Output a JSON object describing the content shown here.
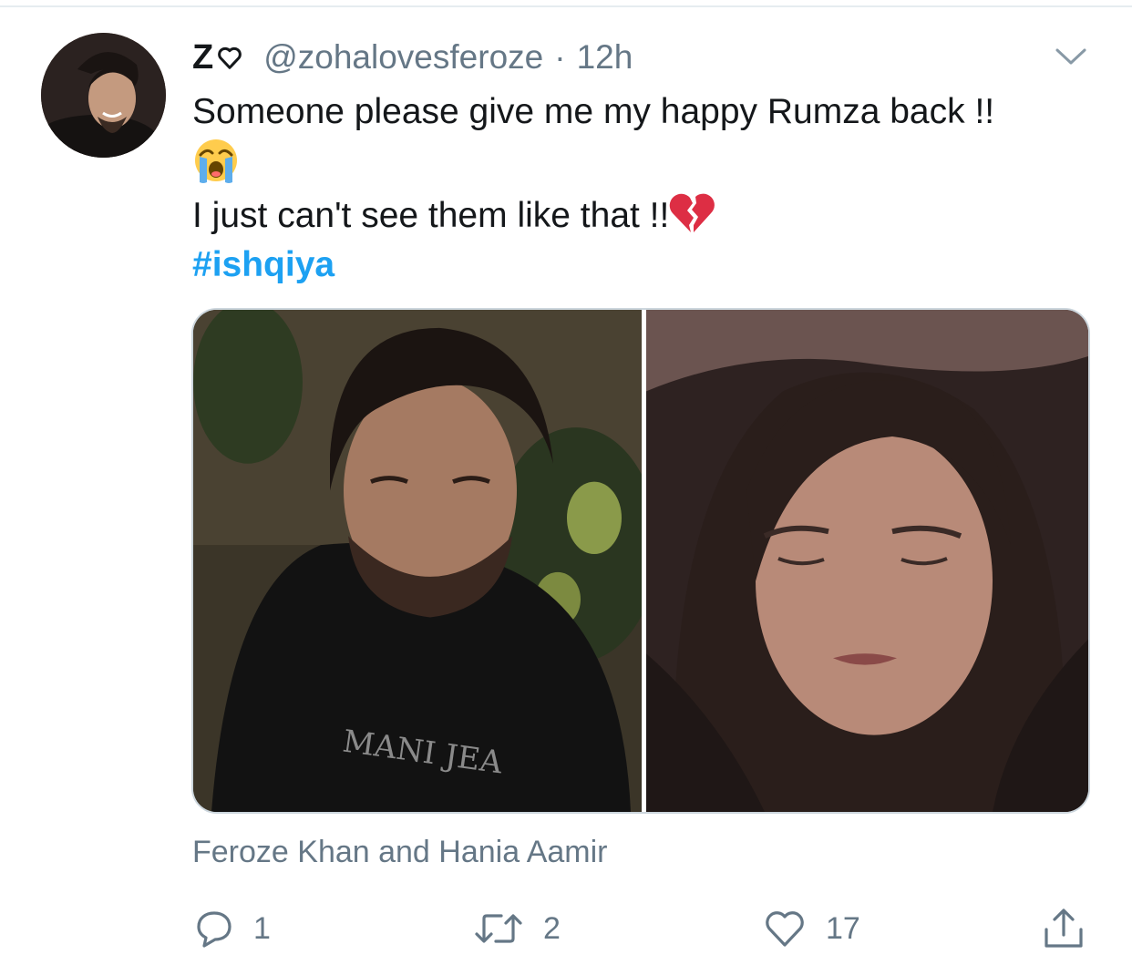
{
  "tweet": {
    "display_name": "Z",
    "handle": "@zohalovesferoze",
    "separator": "·",
    "time": "12h",
    "text_line1": "Someone please give me my happy Rumza back !!",
    "text_line3": "I just can't see them like that !!",
    "hashtag": "#ishqiya",
    "media_caption": "Feroze Khan and Hania Aamir"
  },
  "actions": {
    "reply_count": "1",
    "retweet_count": "2",
    "like_count": "17"
  },
  "icons": {
    "name_suffix": "heart-outline-icon",
    "menu": "chevron-down-icon",
    "emoji_1": "loudly-crying-face-emoji",
    "emoji_2": "broken-heart-emoji",
    "reply": "reply-icon",
    "retweet": "retweet-icon",
    "like": "heart-icon",
    "share": "share-icon"
  },
  "colors": {
    "text": "#14171a",
    "secondary": "#657786",
    "link": "#1da1f2",
    "border": "#ccd6dd"
  }
}
